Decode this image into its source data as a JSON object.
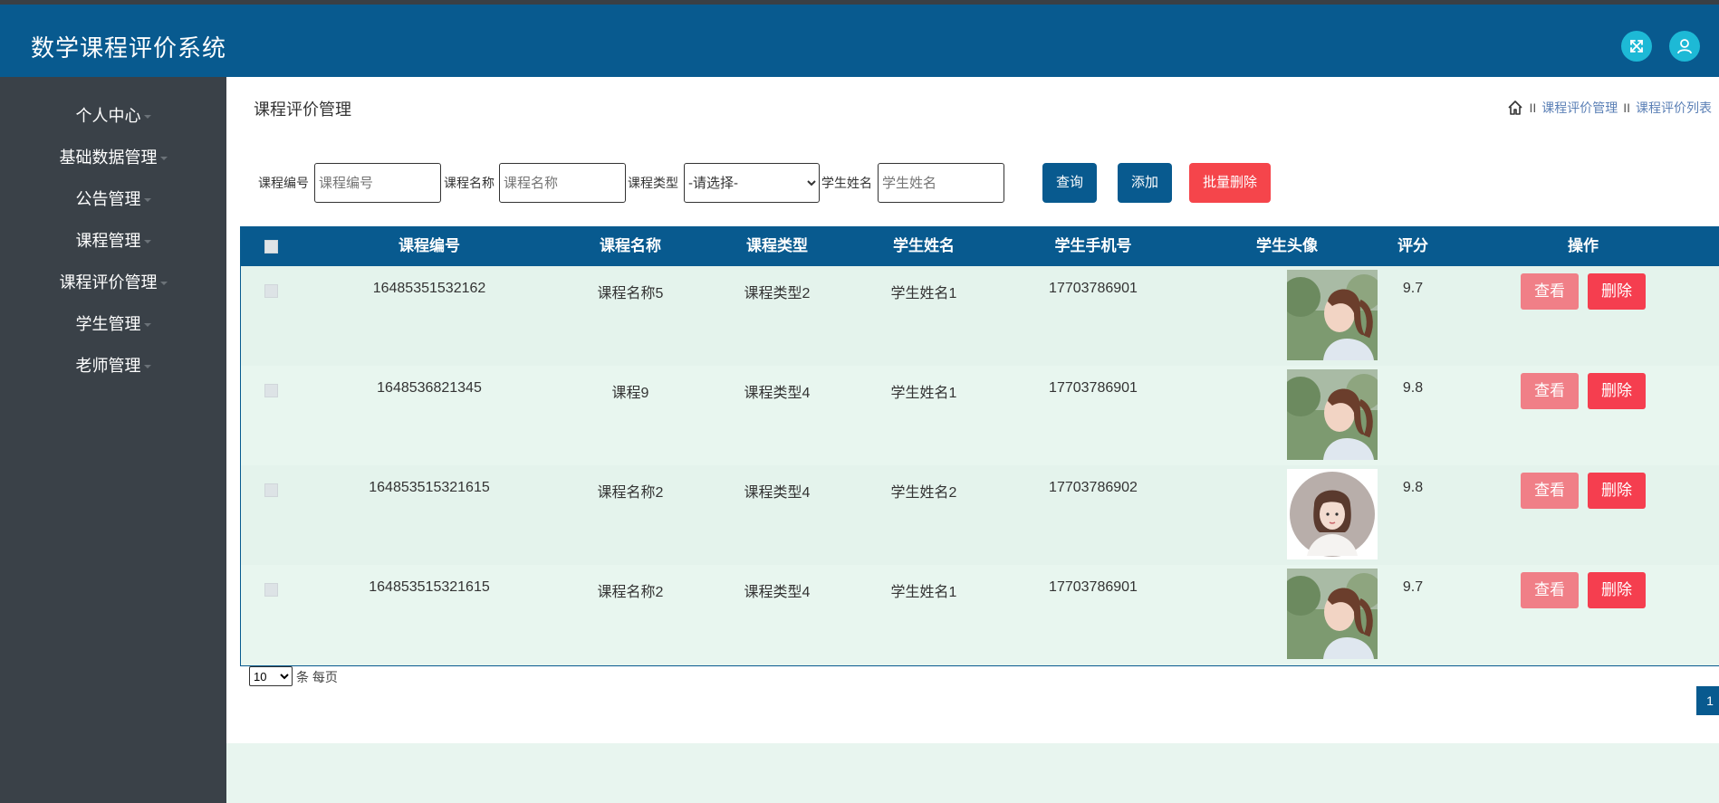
{
  "header": {
    "title": "数学课程评价系统",
    "fullscreen_icon": "expand-icon",
    "user_icon": "user-icon",
    "background": "#085a8f",
    "icon_button_color": "#1db9d6"
  },
  "sidebar": {
    "items": [
      {
        "label": "个人中心"
      },
      {
        "label": "基础数据管理"
      },
      {
        "label": "公告管理"
      },
      {
        "label": "课程管理"
      },
      {
        "label": "课程评价管理"
      },
      {
        "label": "学生管理"
      },
      {
        "label": "老师管理"
      }
    ]
  },
  "page": {
    "title": "课程评价管理",
    "breadcrumb": [
      "课程评价管理",
      "课程评价列表"
    ],
    "breadcrumb_sep": "II"
  },
  "search": {
    "course_no_label": "课程编号",
    "course_no_placeholder": "课程编号",
    "course_name_label": "课程名称",
    "course_name_placeholder": "课程名称",
    "course_type_label": "课程类型",
    "course_type_selected": "-请选择-",
    "student_name_label": "学生姓名",
    "student_name_placeholder": "学生姓名",
    "query_label": "查询",
    "add_label": "添加",
    "batch_delete_label": "批量删除"
  },
  "table": {
    "columns": [
      "课程编号",
      "课程名称",
      "课程类型",
      "学生姓名",
      "学生手机号",
      "学生头像",
      "评分",
      "操作"
    ],
    "rows": [
      {
        "course_no": "16485351532162",
        "course_name": "课程名称5",
        "course_type": "课程类型2",
        "student_name": "学生姓名1",
        "phone": "17703786901",
        "avatar": "ponytail-girl-avatar",
        "score": "9.7",
        "view": "查看",
        "delete": "删除"
      },
      {
        "course_no": "1648536821345",
        "course_name": "课程9",
        "course_type": "课程类型4",
        "student_name": "学生姓名1",
        "phone": "17703786901",
        "avatar": "ponytail-girl-avatar",
        "score": "9.8",
        "view": "查看",
        "delete": "删除"
      },
      {
        "course_no": "164853515321615",
        "course_name": "课程名称2",
        "course_type": "课程类型4",
        "student_name": "学生姓名2",
        "phone": "17703786902",
        "avatar": "bob-hair-girl-avatar",
        "score": "9.8",
        "view": "查看",
        "delete": "删除"
      },
      {
        "course_no": "164853515321615",
        "course_name": "课程名称2",
        "course_type": "课程类型4",
        "student_name": "学生姓名1",
        "phone": "17703786901",
        "avatar": "ponytail-girl-avatar",
        "score": "9.7",
        "view": "查看",
        "delete": "删除"
      }
    ]
  },
  "pagination": {
    "page_size": "10",
    "page_size_suffix": "条 每页",
    "current_page": "1"
  },
  "colors": {
    "primary": "#085a8f",
    "view_button": "#f07f87",
    "delete_button": "#f53e4f",
    "batch_delete": "#f5454b",
    "row_bg": "#e4f3ec",
    "sidebar_bg": "#3a4148"
  }
}
